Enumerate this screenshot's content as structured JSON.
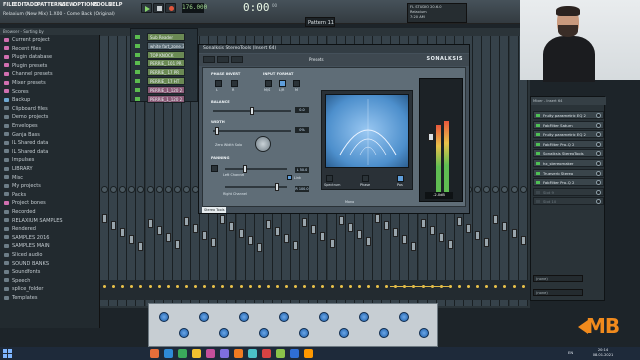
{
  "app": {
    "menu": [
      "FILE",
      "EDIT",
      "ADD",
      "PATTERNS",
      "VIEW",
      "OPTIONS",
      "TOOLS",
      "HELP"
    ],
    "song_title": "Relaxium  (New Mix) 1.X00 - Come Back (Original)",
    "tempo": "176.000",
    "time": "0:00",
    "time_unit": "00",
    "pattern": "Pattern 11",
    "cpu_info": [
      "FL STUDIO 20.6.0",
      "Relaxium",
      "7:20 AM"
    ]
  },
  "browser": {
    "header": "Browser - Sorting by",
    "items": [
      {
        "label": "Current project",
        "style": "pink"
      },
      {
        "label": "Recent files",
        "style": "pink"
      },
      {
        "label": "Plugin database",
        "style": "pink"
      },
      {
        "label": "Plugin presets",
        "style": "pink"
      },
      {
        "label": "Channel presets",
        "style": "pink"
      },
      {
        "label": "Mixer presets",
        "style": "pink"
      },
      {
        "label": "Scores",
        "style": "pink"
      },
      {
        "label": "Backup",
        "style": "blue"
      },
      {
        "label": "Clipboard files",
        "style": ""
      },
      {
        "label": "Demo projects",
        "style": ""
      },
      {
        "label": "Envelopes",
        "style": ""
      },
      {
        "label": "Ganja Bass",
        "style": ""
      },
      {
        "label": "IL Shared data",
        "style": ""
      },
      {
        "label": "IL Shared data",
        "style": ""
      },
      {
        "label": "Impulses",
        "style": ""
      },
      {
        "label": "LIBRARY",
        "style": ""
      },
      {
        "label": "Misc",
        "style": ""
      },
      {
        "label": "My projects",
        "style": ""
      },
      {
        "label": "Packs",
        "style": ""
      },
      {
        "label": "Project bones",
        "style": "pink"
      },
      {
        "label": "Recorded",
        "style": ""
      },
      {
        "label": "RELAXIUM SAMPLES",
        "style": ""
      },
      {
        "label": "Rendered",
        "style": ""
      },
      {
        "label": "SAMPLES 2016",
        "style": ""
      },
      {
        "label": "SAMPLES MAIN",
        "style": ""
      },
      {
        "label": "Sliced audio",
        "style": ""
      },
      {
        "label": "SOUND BANKS",
        "style": ""
      },
      {
        "label": "Soundfonts",
        "style": ""
      },
      {
        "label": "Speech",
        "style": ""
      },
      {
        "label": "splice_folder",
        "style": ""
      },
      {
        "label": "Templates",
        "style": ""
      }
    ]
  },
  "channel_rack": {
    "title": "Channel rack",
    "channels": [
      {
        "name": "Sub Reader",
        "style": "green"
      },
      {
        "name": "white fart_zone.3",
        "style": ""
      },
      {
        "name": "TOP KNOCK",
        "style": "green"
      },
      {
        "name": "PERRIE_ 101 PR",
        "style": "green"
      },
      {
        "name": "PERRIE_ 17 PR",
        "style": "green"
      },
      {
        "name": "PERRIE_ 17 HT",
        "style": "green"
      },
      {
        "name": "PERRIE_1_120 2..",
        "style": "pink"
      },
      {
        "name": "PERRIE_1_120 2..",
        "style": "pink"
      }
    ]
  },
  "plugin": {
    "title": "Sonalksis StereoTools (Insert 64)",
    "presets_label": "Presets",
    "brand": "SONALKSIS",
    "sections": {
      "phase_invert": "PHASE INVERT",
      "input_format": "INPUT FORMAT",
      "balance": "BALANCE",
      "width": "WIDTH",
      "zero_width": "Zero Width Solo",
      "panning": "PANNING",
      "left_channel": "Left Channel",
      "right_channel": "Right Channel",
      "link": "Link",
      "mono": "Mono",
      "spectrum": "Spectrum",
      "phase": "Phase",
      "pos": "Pos"
    },
    "values": {
      "balance": "0.0",
      "width": "0%",
      "left": "L 50.0",
      "right": "R 100.0",
      "gain": "-2.0dB"
    },
    "phase_buttons": [
      "L",
      "R"
    ],
    "format_buttons": [
      "M/S",
      "L/R",
      "M"
    ],
    "footer_name": "Stereo Tools"
  },
  "inserts": {
    "header": "Mixer - Insert 64",
    "slots": [
      {
        "label": "Fruity parametric EQ 2",
        "empty": false
      },
      {
        "label": "FabFilter Saturn",
        "empty": false
      },
      {
        "label": "Fruity parametric EQ 2",
        "empty": false
      },
      {
        "label": "FabFilter Pro-Q 2",
        "empty": false
      },
      {
        "label": "Sonalksis StereoTools",
        "empty": false
      },
      {
        "label": "hx_stereomaker",
        "empty": false
      },
      {
        "label": "Trueverb Stereo",
        "empty": false
      },
      {
        "label": "FabFilter Pro-Q 2",
        "empty": false
      },
      {
        "label": "Slot 9",
        "empty": true
      },
      {
        "label": "Slot 10",
        "empty": true
      }
    ],
    "none_1": "(none)",
    "none_2": "(none)"
  },
  "taskbar": {
    "lang": "EN",
    "time": "20:14",
    "date": "08.01.2021"
  },
  "logo": {
    "text": "MB"
  },
  "colors": {
    "accent_orange": "#f08a1d",
    "led_green": "#4fbf55",
    "scope_blue": "#4d8fcc"
  }
}
